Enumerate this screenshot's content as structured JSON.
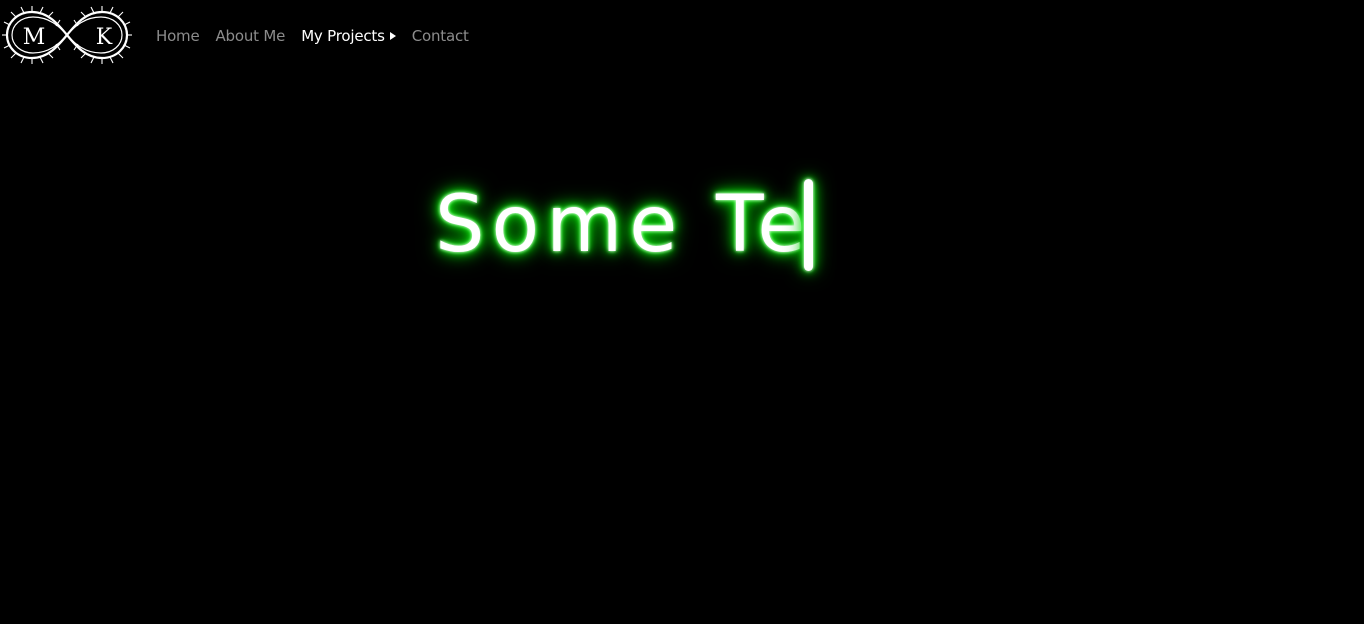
{
  "logo": {
    "letter_left": "M",
    "letter_right": "K",
    "icon": "infinity-logo-icon"
  },
  "nav": {
    "items": [
      {
        "label": "Home",
        "active": false
      },
      {
        "label": "About Me",
        "active": false
      },
      {
        "label": "My Projects",
        "active": true,
        "icon": "caret-right-icon"
      },
      {
        "label": "Contact",
        "active": false
      }
    ]
  },
  "hero": {
    "typed_text": "Some Te",
    "cursor_icon": "text-cursor-icon",
    "glow_color": "#00ff00"
  },
  "colors": {
    "background": "#000000",
    "nav_inactive": "#8c8c8c",
    "nav_active": "#ffffff",
    "glow": "#00ff00"
  }
}
